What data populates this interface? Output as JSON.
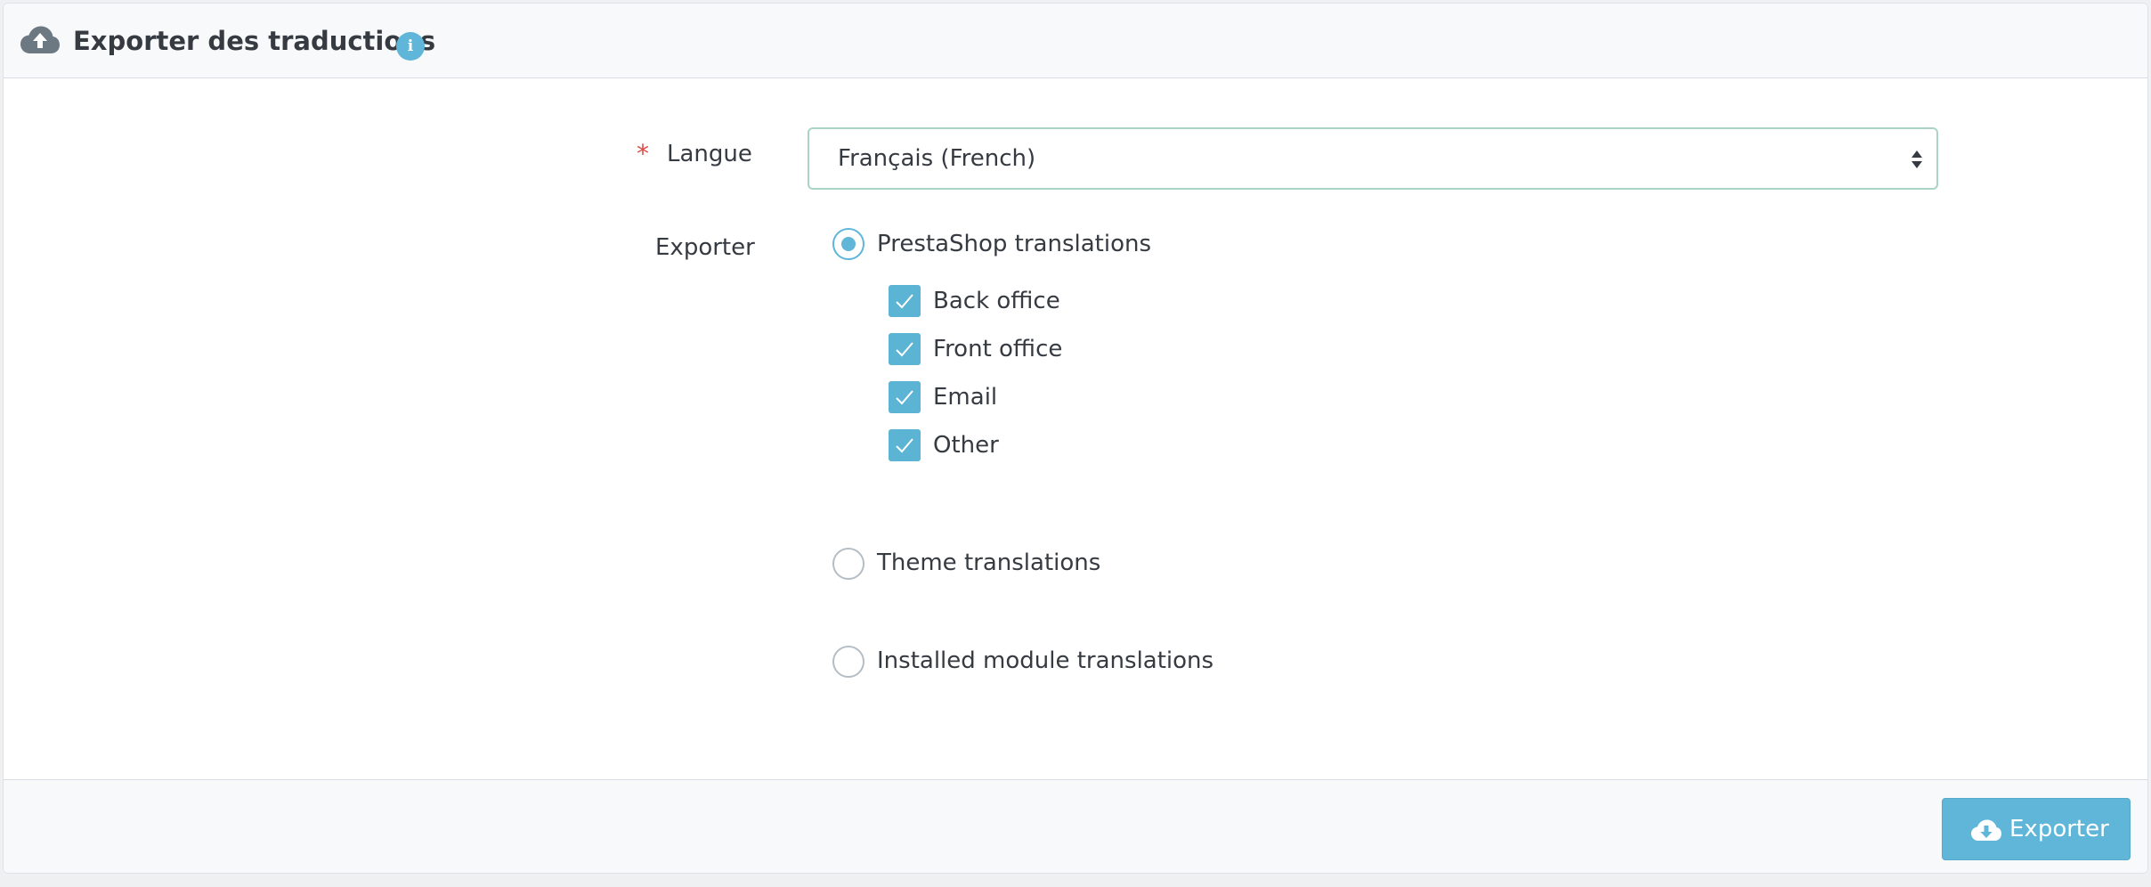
{
  "header": {
    "title": "Exporter des traductions",
    "title_icon": "cloud-upload-icon",
    "info_icon": "info-icon",
    "info_glyph": "i"
  },
  "form": {
    "language": {
      "label": "Langue",
      "required_mark": "*",
      "selected": "Français (French)"
    },
    "export": {
      "label": "Exporter",
      "options": [
        {
          "label": "PrestaShop translations",
          "checked": true
        },
        {
          "label": "Theme translations",
          "checked": false
        },
        {
          "label": "Installed module translations",
          "checked": false
        }
      ],
      "prestashop_parts": [
        {
          "label": "Back office",
          "checked": true
        },
        {
          "label": "Front office",
          "checked": true
        },
        {
          "label": "Email",
          "checked": true
        },
        {
          "label": "Other",
          "checked": true
        }
      ]
    }
  },
  "footer": {
    "export_button_label": "Exporter",
    "export_button_icon": "cloud-download-icon"
  },
  "colors": {
    "accent": "#5fb6d8",
    "required": "#e04a43",
    "text": "#363a41"
  }
}
